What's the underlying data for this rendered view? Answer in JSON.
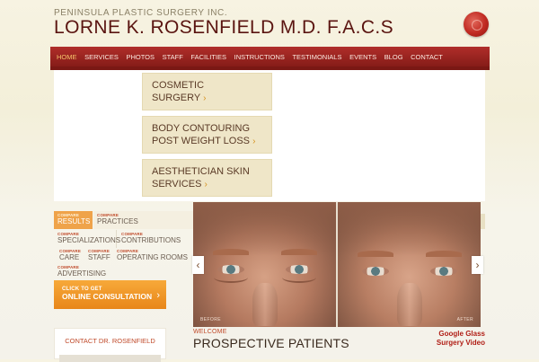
{
  "header": {
    "company": "PENINSULA PLASTIC SURGERY INC.",
    "doctor": "LORNE K. ROSENFIELD M.D. F.A.C.S"
  },
  "nav": {
    "items": [
      "HOME",
      "SERVICES",
      "PHOTOS",
      "STAFF",
      "FACILITIES",
      "INSTRUCTIONS",
      "TESTIMONIALS",
      "EVENTS",
      "BLOG",
      "CONTACT"
    ],
    "active": "HOME"
  },
  "promos": [
    {
      "line1": "COSMETIC",
      "line2": "SURGERY",
      "arrow": "›"
    },
    {
      "line1": "BODY CONTOURING",
      "line2": "POST WEIGHT LOSS",
      "arrow": "›"
    },
    {
      "line1": "AESTHETICIAN SKIN",
      "line2": "SERVICES",
      "arrow": "›"
    }
  ],
  "compare_tabs": {
    "small": "COMPARE",
    "items": [
      "RESULTS",
      "PRACTICES",
      "SPECIALIZATIONS",
      "CONTRIBUTIONS",
      "CARE",
      "STAFF",
      "OPERATING ROOMS",
      "ADVERTISING"
    ],
    "active": "RESULTS"
  },
  "cta": {
    "small": "CLICK TO GET",
    "main": "ONLINE CONSULTATION",
    "arrow": "›"
  },
  "contact": {
    "title": "CONTACT DR. ROSENFIELD"
  },
  "slider": {
    "before_label": "BEFORE",
    "after_label": "AFTER",
    "prev": "‹",
    "next": "›"
  },
  "welcome": {
    "small": "WELCOME",
    "title": "PROSPECTIVE PATIENTS"
  },
  "video_link": {
    "line1": "Google Glass",
    "line2": "Surgery Video"
  }
}
